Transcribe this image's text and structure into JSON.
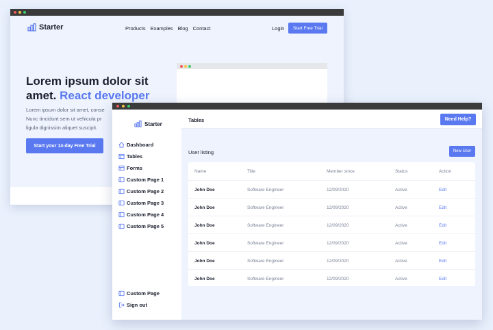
{
  "colors": {
    "accent": "#5a79f0",
    "background": "#eaf1fd",
    "titlebar": "#3b3b3b"
  },
  "landing": {
    "logo_text": "Starter",
    "nav": [
      "Products",
      "Examples",
      "Blog",
      "Contact"
    ],
    "login": "Login",
    "trial_button": "Start Free Trial",
    "headline_line1": "Lorem ipsum dolor sit",
    "headline_line2_plain": "amet.",
    "headline_line2_accent": "React developer",
    "paragraph": [
      "Lorem ipsum dolor sit amet, conse",
      "Nunc tincidunt sem ut vehicula pr",
      "ligula dignissim aliquet suscipit."
    ],
    "cta": "Start your 14-day Free Trial"
  },
  "dashboard": {
    "logo_text": "Starter",
    "topbar_title": "Tables",
    "help_button": "Need Help?",
    "sidebar": [
      {
        "label": "Dashboard",
        "icon": "home-icon"
      },
      {
        "label": "Tables",
        "icon": "table-icon"
      },
      {
        "label": "Forms",
        "icon": "table-icon"
      },
      {
        "label": "Custom Page 1",
        "icon": "page-icon"
      },
      {
        "label": "Custom Page 2",
        "icon": "page-icon"
      },
      {
        "label": "Custom Page 3",
        "icon": "page-icon"
      },
      {
        "label": "Custom Page 4",
        "icon": "page-icon"
      },
      {
        "label": "Custom Page 5",
        "icon": "page-icon"
      }
    ],
    "sidebar_bottom": [
      {
        "label": "Custom Page",
        "icon": "page-icon"
      },
      {
        "label": "Sign out",
        "icon": "sign-out-icon"
      }
    ],
    "listing_title": "User listing",
    "new_user_button": "New User",
    "table": {
      "headers": [
        "Name",
        "Title",
        "Member since",
        "Status",
        "Action"
      ],
      "rows": [
        [
          "John Doe",
          "Software Engineer",
          "12/09/2020",
          "Active",
          "Edit"
        ],
        [
          "John Doe",
          "Software Engineer",
          "12/09/2020",
          "Active",
          "Edit"
        ],
        [
          "John Doe",
          "Software Engineer",
          "12/09/2020",
          "Active",
          "Edit"
        ],
        [
          "John Doe",
          "Software Engineer",
          "12/09/2020",
          "Active",
          "Edit"
        ],
        [
          "John Doe",
          "Software Engineer",
          "12/09/2020",
          "Active",
          "Edit"
        ],
        [
          "John Doe",
          "Software Engineer",
          "12/09/2020",
          "Active",
          "Edit"
        ]
      ]
    }
  }
}
